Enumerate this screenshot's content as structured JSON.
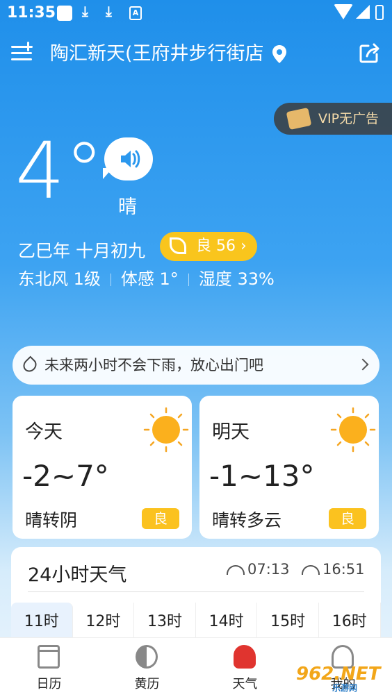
{
  "status_bar": {
    "time": "11:35"
  },
  "header": {
    "location": "陶汇新天(王府井步行街店"
  },
  "vip": {
    "label": "VIP无广告"
  },
  "current": {
    "temperature": "4°",
    "condition": "晴",
    "lunar_date": "乙巳年 十月初九",
    "aqi_label": "良 56 ›",
    "wind": "东北风 1级",
    "feels_like": "体感 1°",
    "humidity": "湿度 33%"
  },
  "rain_notice": {
    "text": "未来两小时不会下雨，放心出门吧"
  },
  "days": [
    {
      "label": "今天",
      "temp_range": "-2~7°",
      "condition": "晴转阴",
      "aqi": "良"
    },
    {
      "label": "明天",
      "temp_range": "-1~13°",
      "condition": "晴转多云",
      "aqi": "良"
    }
  ],
  "hourly": {
    "title": "24小时天气",
    "sunrise": "07:13",
    "sunset": "16:51",
    "hours": [
      "11时",
      "12时",
      "13时",
      "14时",
      "15时",
      "16时"
    ]
  },
  "tabs": [
    {
      "label": "日历",
      "icon": "calendar-icon"
    },
    {
      "label": "黄历",
      "icon": "yin-yang-icon"
    },
    {
      "label": "天气",
      "icon": "weather-icon"
    },
    {
      "label": "我的",
      "icon": "profile-icon"
    }
  ],
  "watermark": {
    "text": "962.NET",
    "sub": "乐游网"
  },
  "colors": {
    "sky_top": "#1f8fea",
    "aqi_yellow": "#f9c51d",
    "active_tab": "#e0342f"
  }
}
